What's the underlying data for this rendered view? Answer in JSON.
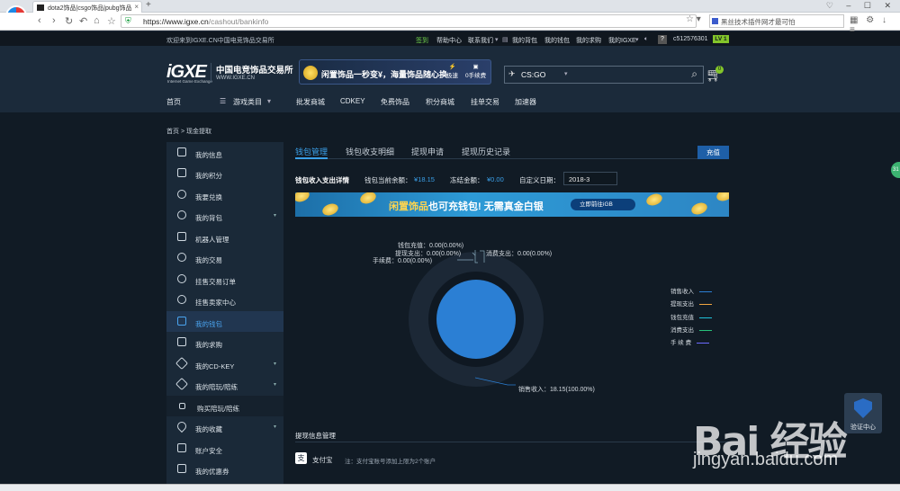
{
  "browser": {
    "tab_title": "dota2饰品|csgo饰品|pubg饰品",
    "url_host": "https://www.igxe.cn",
    "url_path": "/cashout/bankinfo",
    "search_text": "黑丝技术插件网才最可怕"
  },
  "topbar": {
    "welcome": "欢迎来到IGXE.CN中国电竞饰品交易所",
    "links": [
      "签到",
      "帮助中心",
      "联系我们",
      "我的背包",
      "我的钱包",
      "我的求购",
      "我的IGXE",
      "c512576301"
    ],
    "level": "LV 1",
    "help_icon": "?"
  },
  "header": {
    "brand": "iGXE",
    "brand_sub": "Internet Game Exchange",
    "brand_cn": "中国电竞饰品交易所",
    "brand_url": "WWW.IGXE.CN",
    "banner": "闲置饰品一秒变¥，海量饰品随心换",
    "banner_icons": [
      "极速",
      "0手续费"
    ],
    "game_select": "CS:GO",
    "cart_count": "0"
  },
  "main_nav": [
    "首页",
    "游戏类目",
    "批发商城",
    "CDKEY",
    "免费饰品",
    "积分商城",
    "挂单交易",
    "加速器"
  ],
  "breadcrumb": "首页 > 现金提取",
  "sidebar": [
    {
      "label": "我的信息",
      "arrow": false
    },
    {
      "label": "我的积分",
      "arrow": false
    },
    {
      "label": "我要兑换",
      "arrow": false
    },
    {
      "label": "我的背包",
      "arrow": true
    },
    {
      "label": "机器人管理",
      "arrow": false
    },
    {
      "label": "我的交易",
      "arrow": false
    },
    {
      "label": "挂售交易订单",
      "arrow": false
    },
    {
      "label": "挂售卖家中心",
      "arrow": false
    },
    {
      "label": "我的钱包",
      "arrow": false
    },
    {
      "label": "我的求购",
      "arrow": false
    },
    {
      "label": "我的CD-KEY",
      "arrow": true
    },
    {
      "label": "我的陪玩/陪练",
      "arrow": true
    },
    {
      "label": "购买陪玩/陪练",
      "arrow": false
    },
    {
      "label": "我的收藏",
      "arrow": true
    },
    {
      "label": "账户安全",
      "arrow": false
    },
    {
      "label": "我的优惠券",
      "arrow": false
    }
  ],
  "tabs": [
    "钱包管理",
    "钱包收支明细",
    "提现申请",
    "提现历史记录"
  ],
  "recharge_button": "充值",
  "wallet_info": {
    "section_label": "钱包收入支出详情",
    "balance_label": "钱包当前余额：",
    "balance_value": "¥18.15",
    "frozen_label": "冻结金额：",
    "frozen_value": "¥0.00",
    "date_label": "自定义日期：",
    "date_value": "2018-3"
  },
  "promo": {
    "text_a": "闲置饰品",
    "text_b": "也可充钱包!",
    "text_c": "无需真金白银",
    "button": "立即前往iGB"
  },
  "chart_data": {
    "type": "pie",
    "slices": [
      {
        "name": "销售收入",
        "value": 18.15,
        "label": "销售收入：18.15(100.00%)",
        "color": "#2b7fd4"
      },
      {
        "name": "提现支出",
        "value": 0.0,
        "label": "提现支出：0.00(0.00%)",
        "color": "#f0a640"
      },
      {
        "name": "钱包充值",
        "value": 0.0,
        "label": "钱包充值：0.00(0.00%)",
        "color": "#1fc1d8"
      },
      {
        "name": "消费支出",
        "value": 0.0,
        "label": "消费支出：0.00(0.00%)",
        "color": "#27c27a"
      },
      {
        "name": "手续费",
        "value": 0.0,
        "label": "手续费：0.00(0.00%)",
        "color": "#6b6bff"
      }
    ],
    "legend": [
      "销售收入",
      "提现支出",
      "钱包充值",
      "消费支出",
      "手 续 费"
    ],
    "legend_position": "right"
  },
  "withdraw": {
    "title": "提现信息管理",
    "method": "支付宝",
    "note": "注：支付宝账号添加上限为2个账户"
  },
  "widgets": {
    "verify": "验证中心",
    "badge": "31"
  },
  "watermark": {
    "main": "Bai  经验",
    "sub": "jingyan.baidu.com"
  },
  "colors": {
    "accent": "#3a9fe8",
    "level": "#83c52a",
    "button": "#1e5fa7"
  }
}
